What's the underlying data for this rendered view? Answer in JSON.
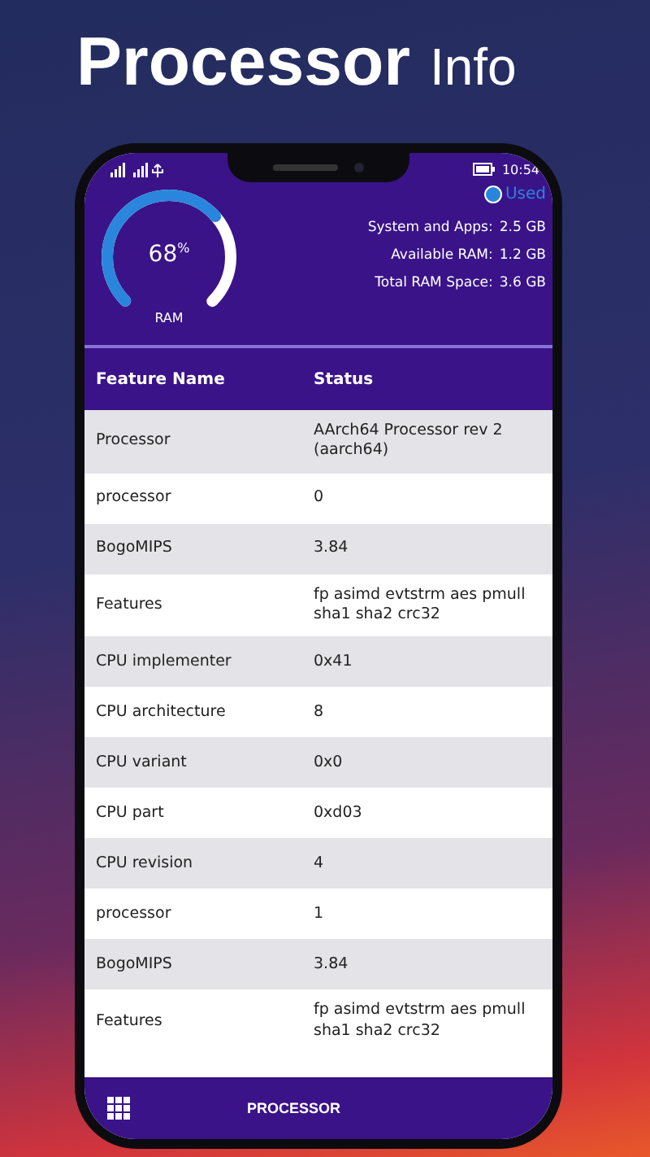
{
  "title": {
    "main": "Processor",
    "sub": "Info"
  },
  "status_bar": {
    "time": "10:54"
  },
  "ram": {
    "percent": "68$^{%}$",
    "label": "RAM",
    "legend": "Used",
    "stats": [
      {
        "label": "System and Apps:",
        "value": "2.5 GB"
      },
      {
        "label": "Available RAM:",
        "value": "1.2 GB"
      },
      {
        "label": "Total RAM Space:",
        "value": "3.6 GB"
      }
    ]
  },
  "table": {
    "columns": [
      "Feature Name",
      "Status"
    ],
    "rows": [
      [
        "Processor",
        "AArch64 Processor rev 2 (aarch64)"
      ],
      [
        "processor",
        "0"
      ],
      [
        "BogoMIPS",
        "3.84"
      ],
      [
        "Features",
        "fp asimd evtstrm aes pmull sha1 sha2 crc32"
      ],
      [
        "CPU implementer",
        "0x41"
      ],
      [
        "CPU architecture",
        "8"
      ],
      [
        "CPU variant",
        "0x0"
      ],
      [
        "CPU part",
        "0xd03"
      ],
      [
        "CPU revision",
        "4"
      ],
      [
        "processor",
        "1"
      ],
      [
        "BogoMIPS",
        "3.84"
      ],
      [
        "Features",
        "fp asimd evtstrm aes pmull sha1 sha2 crc32"
      ]
    ]
  },
  "bottom_nav": {
    "label": "PROCESSOR"
  }
}
